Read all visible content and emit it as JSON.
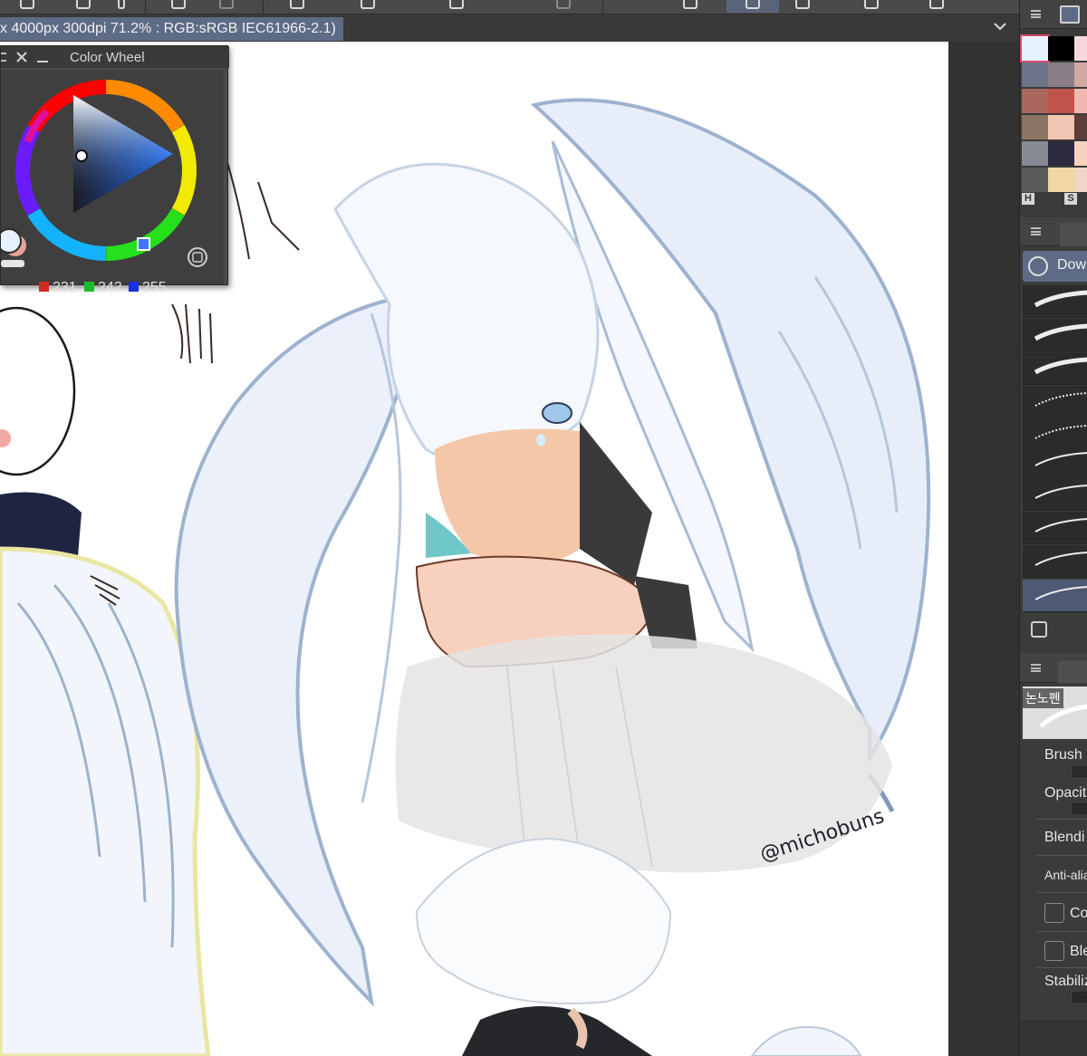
{
  "document": {
    "info": "x 4000px 300dpi 71.2% : RGB:sRGB IEC61966-2.1)"
  },
  "color_wheel": {
    "title": "Color Wheel",
    "r": "231",
    "g": "242",
    "b": "255",
    "current_color": "#e7f2ff"
  },
  "color_set": {
    "h_label": "H",
    "s_label": "S",
    "swatches": [
      "#e7f2ff",
      "#000000",
      "#f6d9dc",
      "#6d7388",
      "#8a7f86",
      "#d0a8a4",
      "#a9665f",
      "#c0534a",
      "#f0b8b0",
      "#8c7562",
      "#f2c6b4",
      "#5d3c3a",
      "#878a93",
      "#2c2a3f",
      "#f7d2bf",
      "#5b5b5b",
      "#f1d7a5",
      "#f3d4c9"
    ]
  },
  "sub_tool": {
    "download_label": "Dow"
  },
  "tool_property": {
    "brush_name": "논노펜",
    "brush_size_label": "Brush",
    "opacity_label": "Opacit",
    "blending_label": "Blendi",
    "anti_alias_label": "Anti-alia",
    "color_check_label": "Co",
    "blend_check_label": "Ble",
    "stabilization_label": "Stabiliz"
  },
  "artwork": {
    "signature": "@michobuns"
  }
}
